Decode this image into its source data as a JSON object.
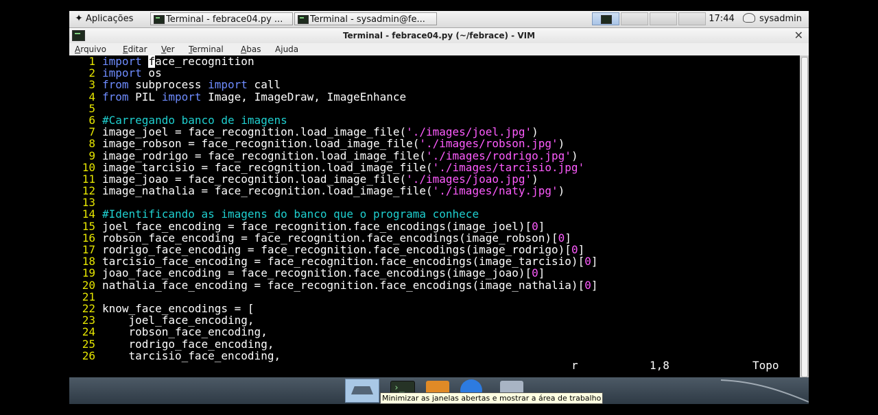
{
  "top_panel": {
    "apps_label": "Aplicações",
    "tasks": [
      {
        "label": "Terminal - febrace04.py ..."
      },
      {
        "label": "Terminal - sysadmin@fe..."
      }
    ],
    "clock": "17:44",
    "user": "sysadmin"
  },
  "window": {
    "title": "Terminal - febrace04.py (~/febrace) - VIM",
    "close_glyph": "✕",
    "menu": [
      "Arquivo",
      "Editar",
      "Ver",
      "Terminal",
      "Abas",
      "Ajuda"
    ]
  },
  "editor": {
    "lines": [
      [
        {
          "t": "import",
          "c": "kw"
        },
        {
          "t": " "
        },
        {
          "t": "f",
          "c": "cur"
        },
        {
          "t": "ace_recognition"
        }
      ],
      [
        {
          "t": "import",
          "c": "kw"
        },
        {
          "t": " os"
        }
      ],
      [
        {
          "t": "from",
          "c": "kw"
        },
        {
          "t": " subprocess "
        },
        {
          "t": "import",
          "c": "kw"
        },
        {
          "t": " call"
        }
      ],
      [
        {
          "t": "from",
          "c": "kw"
        },
        {
          "t": " PIL "
        },
        {
          "t": "import",
          "c": "kw"
        },
        {
          "t": " Image, ImageDraw, ImageEnhance"
        }
      ],
      [],
      [
        {
          "t": "#Carregando banco de imagens",
          "c": "cm"
        }
      ],
      [
        {
          "t": "image_joel = face_recognition.load_image_file("
        },
        {
          "t": "'./images/joel.jpg'",
          "c": "str"
        },
        {
          "t": ")"
        }
      ],
      [
        {
          "t": "image_robson = face_recognition.load_image_file("
        },
        {
          "t": "'./images/robson.jpg'",
          "c": "str"
        },
        {
          "t": ")"
        }
      ],
      [
        {
          "t": "image_rodrigo = face_recognition.load_image_file("
        },
        {
          "t": "'./images/rodrigo.jpg'",
          "c": "str"
        },
        {
          "t": ")"
        }
      ],
      [
        {
          "t": "image_tarcisio = face_recognition.load_image_file("
        },
        {
          "t": "'./images/tarcisio.jpg'",
          "c": "str"
        }
      ],
      [
        {
          "t": "image_joao = face_recognition.load_image_file("
        },
        {
          "t": "'./images/joao.jpg'",
          "c": "str"
        },
        {
          "t": ")"
        }
      ],
      [
        {
          "t": "image_nathalia = face_recognition.load_image_file("
        },
        {
          "t": "'./images/naty.jpg'",
          "c": "str"
        },
        {
          "t": ")"
        }
      ],
      [],
      [
        {
          "t": "#Identificando as imagens do banco que o programa conhece",
          "c": "cm"
        }
      ],
      [
        {
          "t": "joel_face_encoding = face_recognition.face_encodings(image_joel)["
        },
        {
          "t": "0",
          "c": "num"
        },
        {
          "t": "]"
        }
      ],
      [
        {
          "t": "robson_face_encoding = face_recognition.face_encodings(image_robson)["
        },
        {
          "t": "0",
          "c": "num"
        },
        {
          "t": "]"
        }
      ],
      [
        {
          "t": "rodrigo_face_encoding = face_recognition.face_encodings(image_rodrigo)["
        },
        {
          "t": "0",
          "c": "num"
        },
        {
          "t": "]"
        }
      ],
      [
        {
          "t": "tarcisio_face_encoding = face_recognition.face_encodings(image_tarcisio)["
        },
        {
          "t": "0",
          "c": "num"
        },
        {
          "t": "]"
        }
      ],
      [
        {
          "t": "joao_face_encoding = face_recognition.face_encodings(image_joao)["
        },
        {
          "t": "0",
          "c": "num"
        },
        {
          "t": "]"
        }
      ],
      [
        {
          "t": "nathalia_face_encoding = face_recognition.face_encodings(image_nathalia)["
        },
        {
          "t": "0",
          "c": "num"
        },
        {
          "t": "]"
        }
      ],
      [],
      [
        {
          "t": "know_face_encodings = ["
        }
      ],
      [
        {
          "t": "    joel_face_encoding,"
        }
      ],
      [
        {
          "t": "    robson_face_encoding,"
        }
      ],
      [
        {
          "t": "    rodrigo_face_encoding,"
        }
      ],
      [
        {
          "t": "    tarcisio_face_encoding,"
        }
      ]
    ],
    "status": {
      "mode": "r",
      "position": "1,8",
      "scroll": "Topo"
    }
  },
  "dock": {
    "tooltip": "Minimizar as janelas abertas e mostrar a área de trabalho"
  },
  "colors": {
    "keyword": "#6e8cff",
    "comment": "#1fd0d0",
    "string": "#ff5cff",
    "line_number": "#e5e500"
  },
  "icons": {
    "apps": "apps-menu-icon",
    "terminal": "terminal-icon",
    "user": "user-icon",
    "show_desktop": "show-desktop-icon"
  }
}
